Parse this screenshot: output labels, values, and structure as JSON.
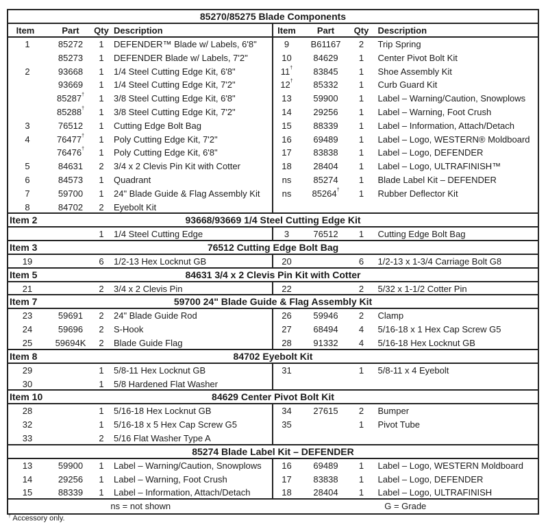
{
  "main": {
    "title": "85270/85275  Blade Components",
    "columns": [
      "Item",
      "Part",
      "Qty",
      "Description"
    ],
    "left": [
      {
        "item": "1",
        "part": "85272",
        "dag": false,
        "qty": "1",
        "desc": "DEFENDER™ Blade w/ Labels, 6'8\""
      },
      {
        "item": "",
        "part": "85273",
        "dag": false,
        "qty": "1",
        "desc": "DEFENDER Blade w/ Labels, 7'2\""
      },
      {
        "item": "2",
        "part": "93668",
        "dag": false,
        "qty": "1",
        "desc": "1/4 Steel Cutting Edge Kit, 6'8\""
      },
      {
        "item": "",
        "part": "93669",
        "dag": false,
        "qty": "1",
        "desc": "1/4 Steel Cutting Edge Kit, 7'2\""
      },
      {
        "item": "",
        "part": "85287",
        "dag": true,
        "qty": "1",
        "desc": "3/8 Steel Cutting Edge Kit, 6'8\""
      },
      {
        "item": "",
        "part": "85288",
        "dag": true,
        "qty": "1",
        "desc": "3/8 Steel Cutting Edge Kit, 7'2\""
      },
      {
        "item": "3",
        "part": "76512",
        "dag": false,
        "qty": "1",
        "desc": "Cutting Edge Bolt Bag"
      },
      {
        "item": "4",
        "part": "76477",
        "dag": true,
        "qty": "1",
        "desc": "Poly Cutting Edge Kit, 7'2\""
      },
      {
        "item": "",
        "part": "76476",
        "dag": true,
        "qty": "1",
        "desc": "Poly Cutting Edge Kit, 6'8\""
      },
      {
        "item": "5",
        "part": "84631",
        "dag": false,
        "qty": "2",
        "desc": "3/4 x 2 Clevis Pin Kit with Cotter"
      },
      {
        "item": "6",
        "part": "84573",
        "dag": false,
        "qty": "1",
        "desc": "Quadrant"
      },
      {
        "item": "7",
        "part": "59700",
        "dag": false,
        "qty": "1",
        "desc": "24\" Blade Guide & Flag Assembly Kit"
      },
      {
        "item": "8",
        "part": "84702",
        "dag": false,
        "qty": "2",
        "desc": "Eyebolt Kit"
      }
    ],
    "right": [
      {
        "item": "9",
        "itemdag": false,
        "part": "B61167",
        "dag": false,
        "qty": "2",
        "desc": "Trip Spring"
      },
      {
        "item": "10",
        "itemdag": false,
        "part": "84629",
        "dag": false,
        "qty": "1",
        "desc": "Center Pivot Bolt Kit"
      },
      {
        "item": "11",
        "itemdag": true,
        "part": "83845",
        "dag": false,
        "qty": "1",
        "desc": "Shoe Assembly Kit"
      },
      {
        "item": "12",
        "itemdag": true,
        "part": "85332",
        "dag": false,
        "qty": "1",
        "desc": "Curb Guard Kit"
      },
      {
        "item": "13",
        "itemdag": false,
        "part": "59900",
        "dag": false,
        "qty": "1",
        "desc": "Label – Warning/Caution, Snowplows"
      },
      {
        "item": "14",
        "itemdag": false,
        "part": "29256",
        "dag": false,
        "qty": "1",
        "desc": "Label – Warning, Foot Crush"
      },
      {
        "item": "15",
        "itemdag": false,
        "part": "88339",
        "dag": false,
        "qty": "1",
        "desc": "Label – Information, Attach/Detach"
      },
      {
        "item": "16",
        "itemdag": false,
        "part": "69489",
        "dag": false,
        "qty": "1",
        "desc": "Label – Logo, WESTERN® Moldboard"
      },
      {
        "item": "17",
        "itemdag": false,
        "part": "83838",
        "dag": false,
        "qty": "1",
        "desc": "Label – Logo, DEFENDER"
      },
      {
        "item": "18",
        "itemdag": false,
        "part": "28404",
        "dag": false,
        "qty": "1",
        "desc": "Label – Logo, ULTRAFINISH™"
      },
      {
        "item": "ns",
        "itemdag": false,
        "part": "85274",
        "dag": false,
        "qty": "1",
        "desc": "Blade Label Kit – DEFENDER"
      },
      {
        "item": "ns",
        "itemdag": false,
        "part": "85264",
        "dag": true,
        "qty": "1",
        "desc": "Rubber Deflector Kit"
      }
    ]
  },
  "kits": [
    {
      "tag": "Item 2",
      "title": "93668/93669  1/4 Steel Cutting Edge Kit",
      "left": [
        {
          "item": "",
          "part": "",
          "qty": "1",
          "desc": "1/4 Steel Cutting Edge"
        }
      ],
      "right": [
        {
          "item": "3",
          "part": "76512",
          "qty": "1",
          "desc": "Cutting Edge Bolt Bag"
        }
      ]
    },
    {
      "tag": "Item 3",
      "title": "76512  Cutting Edge Bolt Bag",
      "left": [
        {
          "item": "19",
          "part": "",
          "qty": "6",
          "desc": "1/2-13 Hex Locknut GB"
        }
      ],
      "right": [
        {
          "item": "20",
          "part": "",
          "qty": "6",
          "desc": "1/2-13 x 1-3/4 Carriage Bolt G8"
        }
      ]
    },
    {
      "tag": "Item 5",
      "title": "84631  3/4 x 2 Clevis Pin Kit with Cotter",
      "left": [
        {
          "item": "21",
          "part": "",
          "qty": "2",
          "desc": "3/4 x 2 Clevis Pin"
        }
      ],
      "right": [
        {
          "item": "22",
          "part": "",
          "qty": "2",
          "desc": "5/32 x 1-1/2 Cotter Pin"
        }
      ]
    },
    {
      "tag": "Item 7",
      "title": "59700  24\" Blade Guide & Flag Assembly Kit",
      "left": [
        {
          "item": "23",
          "part": "59691",
          "qty": "2",
          "desc": "24\" Blade Guide Rod"
        },
        {
          "item": "24",
          "part": "59696",
          "qty": "2",
          "desc": "S-Hook"
        },
        {
          "item": "25",
          "part": "59694K",
          "qty": "2",
          "desc": "Blade Guide Flag"
        }
      ],
      "right": [
        {
          "item": "26",
          "part": "59946",
          "qty": "2",
          "desc": "Clamp"
        },
        {
          "item": "27",
          "part": "68494",
          "qty": "4",
          "desc": "5/16-18 x 1 Hex Cap Screw G5"
        },
        {
          "item": "28",
          "part": "91332",
          "qty": "4",
          "desc": "5/16-18 Hex Locknut GB"
        }
      ]
    },
    {
      "tag": "Item 8",
      "title": "84702  Eyebolt Kit",
      "left": [
        {
          "item": "29",
          "part": "",
          "qty": "1",
          "desc": "5/8-11 Hex Locknut GB"
        },
        {
          "item": "30",
          "part": "",
          "qty": "1",
          "desc": "5/8 Hardened Flat Washer"
        }
      ],
      "right": [
        {
          "item": "31",
          "part": "",
          "qty": "1",
          "desc": "5/8-11 x 4 Eyebolt"
        }
      ]
    },
    {
      "tag": "Item 10",
      "title": "84629  Center Pivot Bolt Kit",
      "left": [
        {
          "item": "28",
          "part": "",
          "qty": "1",
          "desc": "5/16-18 Hex Locknut GB"
        },
        {
          "item": "32",
          "part": "",
          "qty": "1",
          "desc": "5/16-18 x 5 Hex Cap Screw G5"
        },
        {
          "item": "33",
          "part": "",
          "qty": "2",
          "desc": "5/16 Flat Washer Type A"
        }
      ],
      "right": [
        {
          "item": "34",
          "part": "27615",
          "qty": "2",
          "desc": "Bumper"
        },
        {
          "item": "35",
          "part": "",
          "qty": "1",
          "desc": "Pivot Tube"
        }
      ]
    },
    {
      "tag": "",
      "title": "85274  Blade Label Kit – DEFENDER",
      "left": [
        {
          "item": "13",
          "part": "59900",
          "qty": "1",
          "desc": "Label – Warning/Caution, Snowplows"
        },
        {
          "item": "14",
          "part": "29256",
          "qty": "1",
          "desc": "Label – Warning, Foot Crush"
        },
        {
          "item": "15",
          "part": "88339",
          "qty": "1",
          "desc": "Label – Information, Attach/Detach"
        }
      ],
      "right": [
        {
          "item": "16",
          "part": "69489",
          "qty": "1",
          "desc": "Label – Logo, WESTERN Moldboard"
        },
        {
          "item": "17",
          "part": "83838",
          "qty": "1",
          "desc": "Label – Logo, DEFENDER"
        },
        {
          "item": "18",
          "part": "28404",
          "qty": "1",
          "desc": "Label – Logo, ULTRAFINISH"
        }
      ]
    }
  ],
  "footer": {
    "left": "ns = not shown",
    "right": "G = Grade"
  },
  "footnote": {
    "mark": "†",
    "text": " Accessory only."
  }
}
